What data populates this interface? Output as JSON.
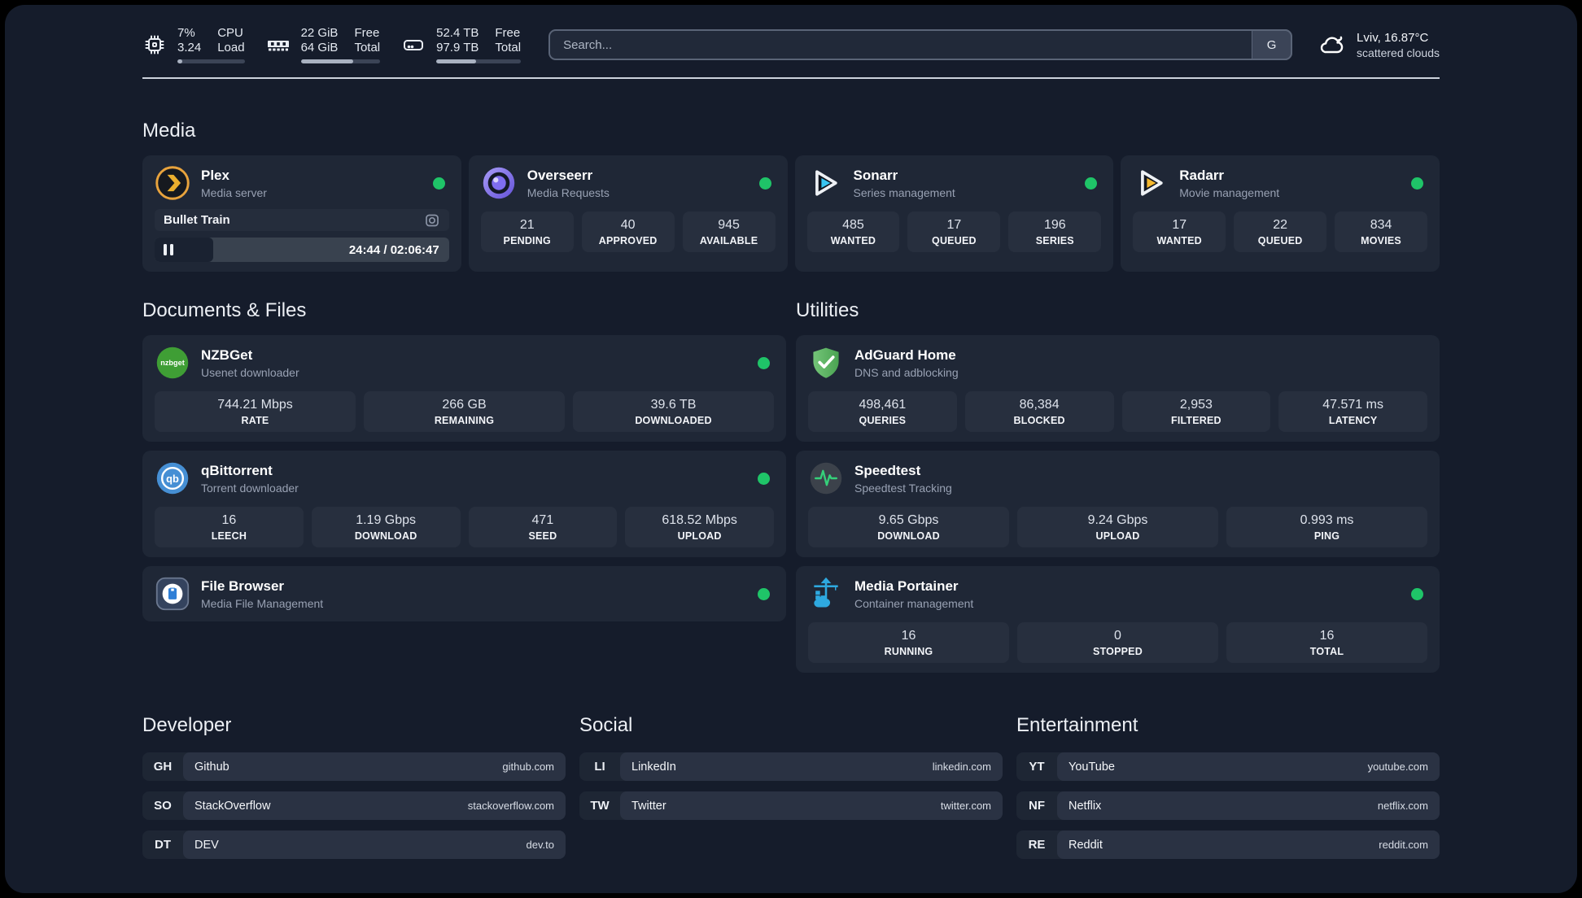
{
  "colors": {
    "background": "#151c2b",
    "card": "#1f2736",
    "tile": "#272f3e",
    "status_online": "#1fc468",
    "divider": "#ccd2dc",
    "plex_accent": "#ebaf2e",
    "sonarr_accent": "#39c5f1",
    "radarr_accent": "#f5b82e",
    "adguard_accent": "#5cb85f",
    "portainer_accent": "#2ea9e0"
  },
  "topbar": {
    "metrics": [
      {
        "icon": "cpu-icon",
        "value_top": "7%",
        "value_bottom": "3.24",
        "label_top": "CPU",
        "label_bottom": "Load",
        "progress_pct": 7
      },
      {
        "icon": "memory-icon",
        "value_top": "22 GiB",
        "value_bottom": "64 GiB",
        "label_top": "Free",
        "label_bottom": "Total",
        "progress_pct": 66
      },
      {
        "icon": "disk-icon",
        "value_top": "52.4 TB",
        "value_bottom": "97.9 TB",
        "label_top": "Free",
        "label_bottom": "Total",
        "progress_pct": 47
      }
    ],
    "search": {
      "placeholder": "Search...",
      "button_label": "G"
    },
    "weather": {
      "location": "Lviv, 16.87°C",
      "condition": "scattered clouds"
    }
  },
  "media": {
    "title": "Media",
    "plex": {
      "name": "Plex",
      "desc": "Media server",
      "now_playing": "Bullet Train",
      "time": "24:44 / 02:06:47",
      "progress_pct": 20
    },
    "overseerr": {
      "name": "Overseerr",
      "desc": "Media Requests",
      "stats": [
        {
          "value": "21",
          "label": "PENDING"
        },
        {
          "value": "40",
          "label": "APPROVED"
        },
        {
          "value": "945",
          "label": "AVAILABLE"
        }
      ]
    },
    "sonarr": {
      "name": "Sonarr",
      "desc": "Series management",
      "stats": [
        {
          "value": "485",
          "label": "WANTED"
        },
        {
          "value": "17",
          "label": "QUEUED"
        },
        {
          "value": "196",
          "label": "SERIES"
        }
      ]
    },
    "radarr": {
      "name": "Radarr",
      "desc": "Movie management",
      "stats": [
        {
          "value": "17",
          "label": "WANTED"
        },
        {
          "value": "22",
          "label": "QUEUED"
        },
        {
          "value": "834",
          "label": "MOVIES"
        }
      ]
    }
  },
  "documents": {
    "title": "Documents & Files",
    "nzbget": {
      "name": "NZBGet",
      "desc": "Usenet downloader",
      "icon_text": "nzbget",
      "stats": [
        {
          "value": "744.21 Mbps",
          "label": "RATE"
        },
        {
          "value": "266 GB",
          "label": "REMAINING"
        },
        {
          "value": "39.6 TB",
          "label": "DOWNLOADED"
        }
      ]
    },
    "qbittorrent": {
      "name": "qBittorrent",
      "desc": "Torrent downloader",
      "icon_text": "qb",
      "stats": [
        {
          "value": "16",
          "label": "LEECH"
        },
        {
          "value": "1.19 Gbps",
          "label": "DOWNLOAD"
        },
        {
          "value": "471",
          "label": "SEED"
        },
        {
          "value": "618.52 Mbps",
          "label": "UPLOAD"
        }
      ]
    },
    "filebrowser": {
      "name": "File Browser",
      "desc": "Media File Management"
    }
  },
  "utilities": {
    "title": "Utilities",
    "adguard": {
      "name": "AdGuard Home",
      "desc": "DNS and adblocking",
      "stats": [
        {
          "value": "498,461",
          "label": "QUERIES"
        },
        {
          "value": "86,384",
          "label": "BLOCKED"
        },
        {
          "value": "2,953",
          "label": "FILTERED"
        },
        {
          "value": "47.571 ms",
          "label": "LATENCY"
        }
      ]
    },
    "speedtest": {
      "name": "Speedtest",
      "desc": "Speedtest Tracking",
      "stats": [
        {
          "value": "9.65 Gbps",
          "label": "DOWNLOAD"
        },
        {
          "value": "9.24 Gbps",
          "label": "UPLOAD"
        },
        {
          "value": "0.993 ms",
          "label": "PING"
        }
      ]
    },
    "portainer": {
      "name": "Media Portainer",
      "desc": "Container management",
      "stats": [
        {
          "value": "16",
          "label": "RUNNING"
        },
        {
          "value": "0",
          "label": "STOPPED"
        },
        {
          "value": "16",
          "label": "TOTAL"
        }
      ]
    }
  },
  "links": {
    "developer": {
      "title": "Developer",
      "items": [
        {
          "abbr": "GH",
          "name": "Github",
          "url": "github.com"
        },
        {
          "abbr": "SO",
          "name": "StackOverflow",
          "url": "stackoverflow.com"
        },
        {
          "abbr": "DT",
          "name": "DEV",
          "url": "dev.to"
        }
      ]
    },
    "social": {
      "title": "Social",
      "items": [
        {
          "abbr": "LI",
          "name": "LinkedIn",
          "url": "linkedin.com"
        },
        {
          "abbr": "TW",
          "name": "Twitter",
          "url": "twitter.com"
        }
      ]
    },
    "entertainment": {
      "title": "Entertainment",
      "items": [
        {
          "abbr": "YT",
          "name": "YouTube",
          "url": "youtube.com"
        },
        {
          "abbr": "NF",
          "name": "Netflix",
          "url": "netflix.com"
        },
        {
          "abbr": "RE",
          "name": "Reddit",
          "url": "reddit.com"
        }
      ]
    }
  }
}
